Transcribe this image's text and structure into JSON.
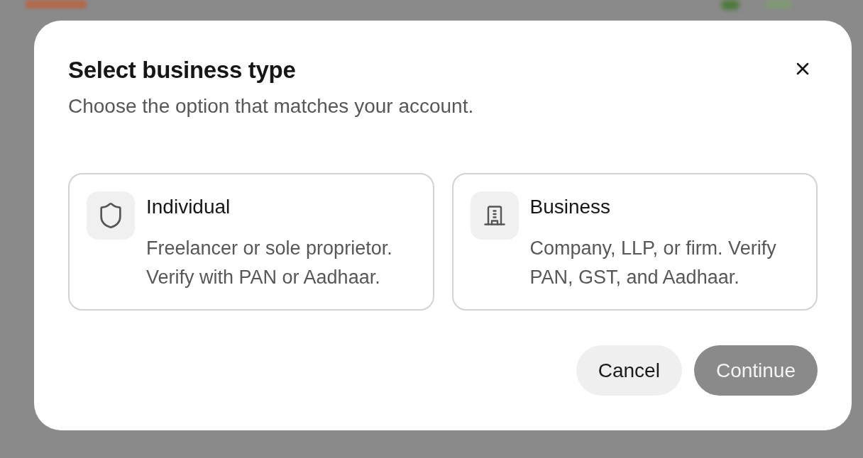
{
  "dialog": {
    "title": "Select business type",
    "subtitle": "Choose the option that matches your account."
  },
  "options": [
    {
      "kind": "individual",
      "title": "Individual",
      "description": "Freelancer or sole proprietor. Verify with PAN or Aadhaar.",
      "selected": false
    },
    {
      "kind": "business",
      "title": "Business",
      "description": "Company, LLP, or firm. Verify PAN, GST, and Aadhaar.",
      "selected": false
    }
  ],
  "buttons": [
    {
      "kind": "secondary",
      "label": "Cancel",
      "disabled": false
    },
    {
      "kind": "primary",
      "label": "Continue",
      "disabled": true
    }
  ]
}
